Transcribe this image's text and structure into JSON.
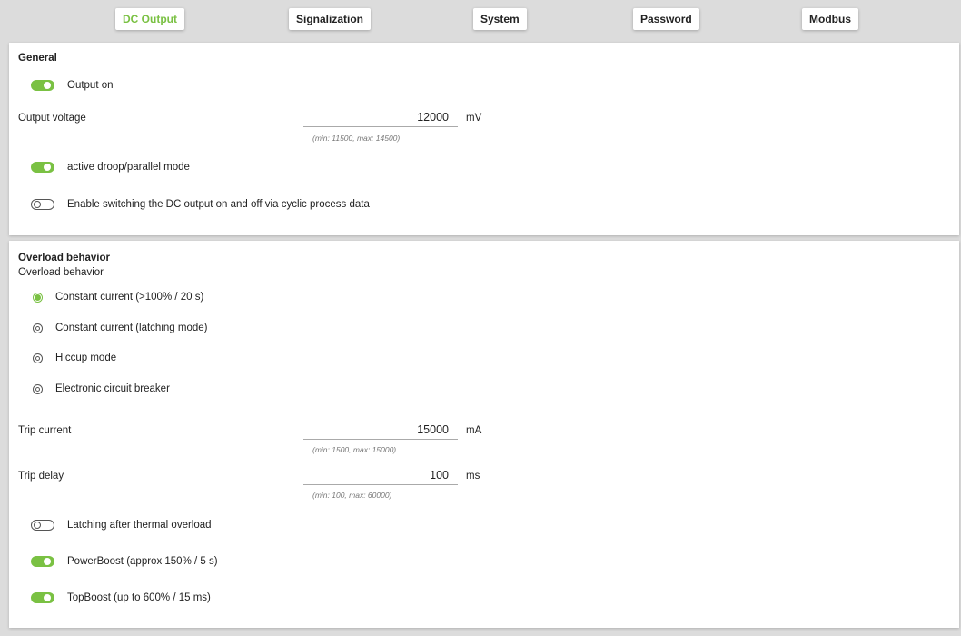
{
  "tabs": [
    {
      "label": "DC Output",
      "active": true
    },
    {
      "label": "Signalization",
      "active": false
    },
    {
      "label": "System",
      "active": false
    },
    {
      "label": "Password",
      "active": false
    },
    {
      "label": "Modbus",
      "active": false
    }
  ],
  "accent_color": "#7ac143",
  "general": {
    "title": "General",
    "output_on": {
      "label": "Output on",
      "on": true
    },
    "output_voltage": {
      "label": "Output voltage",
      "value": "12000",
      "unit": "mV",
      "hint": "(min: 11500, max: 14500)"
    },
    "droop": {
      "label": "active droop/parallel mode",
      "on": true
    },
    "cyclic": {
      "label": "Enable switching the DC output on and off via cyclic process data",
      "on": false
    }
  },
  "overload": {
    "title": "Overload behavior",
    "subtitle": "Overload behavior",
    "options": [
      {
        "label": "Constant current (>100% / 20 s)",
        "selected": true
      },
      {
        "label": "Constant current (latching mode)",
        "selected": false
      },
      {
        "label": "Hiccup mode",
        "selected": false
      },
      {
        "label": "Electronic circuit breaker",
        "selected": false
      }
    ],
    "trip_current": {
      "label": "Trip current",
      "value": "15000",
      "unit": "mA",
      "hint": "(min: 1500, max: 15000)"
    },
    "trip_delay": {
      "label": "Trip delay",
      "value": "100",
      "unit": "ms",
      "hint": "(min: 100, max: 60000)"
    },
    "latching": {
      "label": "Latching after thermal overload",
      "on": false
    },
    "powerboost": {
      "label": "PowerBoost (approx 150% / 5 s)",
      "on": true
    },
    "topboost": {
      "label": "TopBoost (up to 600% / 15 ms)",
      "on": true
    }
  }
}
